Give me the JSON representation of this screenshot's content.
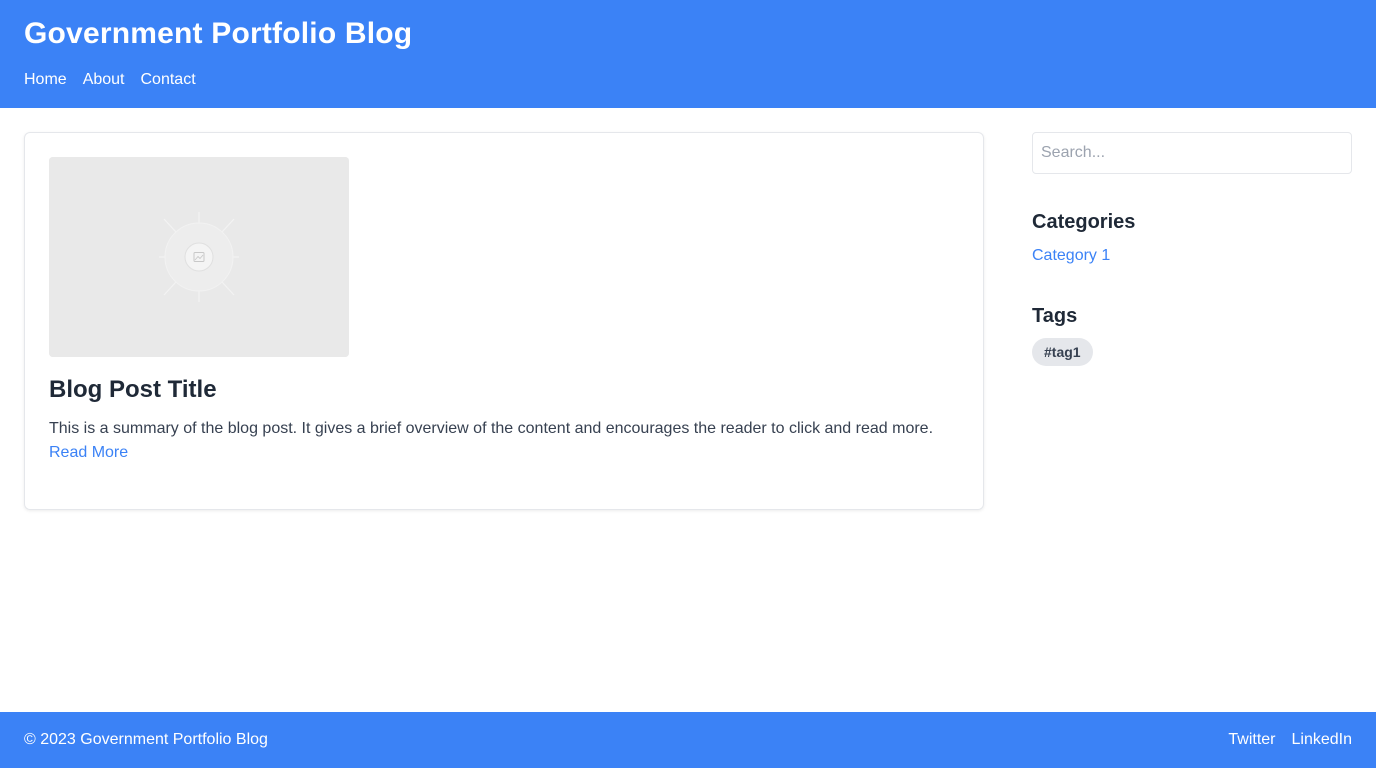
{
  "header": {
    "title": "Government Portfolio Blog",
    "nav": [
      {
        "label": "Home"
      },
      {
        "label": "About"
      },
      {
        "label": "Contact"
      }
    ]
  },
  "post": {
    "image_icon": "image-placeholder-icon",
    "title": "Blog Post Title",
    "summary": "This is a summary of the blog post. It gives a brief overview of the content and encourages the reader to click and read more.",
    "read_more": "Read More"
  },
  "sidebar": {
    "search": {
      "placeholder": "Search...",
      "value": ""
    },
    "categories": {
      "heading": "Categories",
      "items": [
        {
          "label": "Category 1"
        }
      ]
    },
    "tags": {
      "heading": "Tags",
      "items": [
        {
          "label": "#tag1"
        }
      ]
    }
  },
  "footer": {
    "copyright": "© 2023 Government Portfolio Blog",
    "links": [
      {
        "label": "Twitter"
      },
      {
        "label": "LinkedIn"
      }
    ]
  },
  "colors": {
    "brand": "#3b82f6",
    "text": "#1f2937",
    "tag_bg": "#e5e7eb"
  }
}
